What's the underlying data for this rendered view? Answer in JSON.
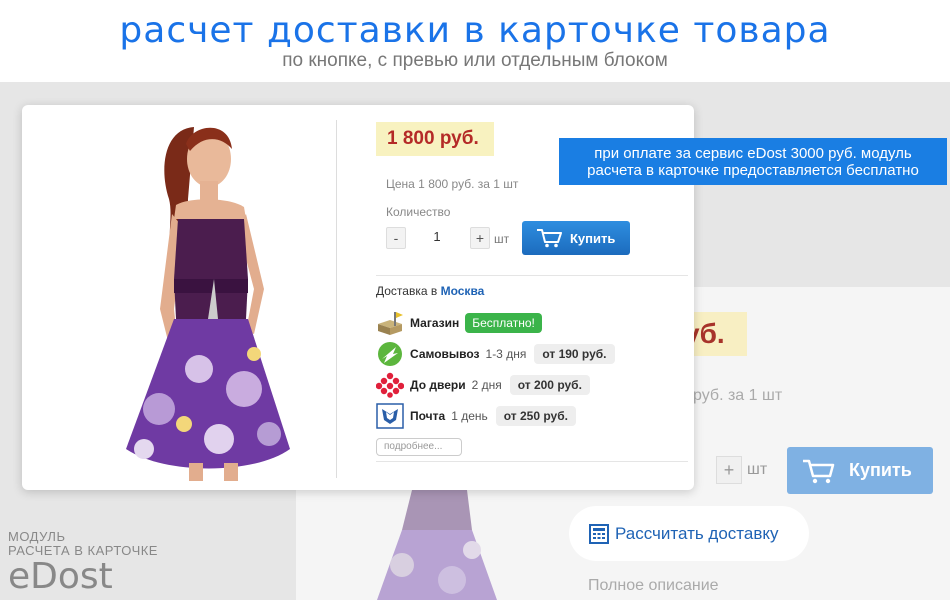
{
  "header": {
    "title": "расчет доставки в карточке товара",
    "subtitle": "по кнопке, с превью или отдельным блоком"
  },
  "watermark": {
    "line1": "МОДУЛЬ",
    "line2": "РАСЧЕТА В КАРТОЧКЕ",
    "brand": "eDost"
  },
  "banner": {
    "line1": "при оплате за сервис eDost 3000 руб. модуль",
    "line2": "расчета в карточке предоставляется бесплатно"
  },
  "product": {
    "price": "1 800 руб.",
    "price_note": "Цена 1 800 руб. за 1 шт",
    "quantity_label": "Количество",
    "quantity_value": "1",
    "minus": "-",
    "plus": "+",
    "unit": "шт",
    "buy_label": "Купить"
  },
  "delivery": {
    "heading": "Доставка в",
    "city": "Москва",
    "options": [
      {
        "name": "Магазин",
        "badge": "Бесплатно!",
        "icon": "shop-icon"
      },
      {
        "name": "Самовывоз",
        "time": "1-3 дня",
        "price": "от 190 руб.",
        "icon": "pickup-icon"
      },
      {
        "name": "До двери",
        "time": "2 дня",
        "price": "от 200 руб.",
        "icon": "courier-icon"
      },
      {
        "name": "Почта",
        "time": "1 день",
        "price": "от 250 руб.",
        "icon": "post-icon"
      }
    ],
    "more": "подробнее..."
  },
  "background_card": {
    "price_fragment": "уб.",
    "price_note_fragment": "руб. за 1 шт",
    "plus": "+",
    "unit": "шт",
    "buy_label": "Купить",
    "calc_label": "Рассчитать доставку",
    "description": "Полное описание"
  },
  "colors": {
    "accent": "#1a73e8",
    "button": "#1c6bbd",
    "price_bg": "#f8f2c0",
    "price_text": "#b42a27",
    "free_badge": "#3bb44a"
  }
}
